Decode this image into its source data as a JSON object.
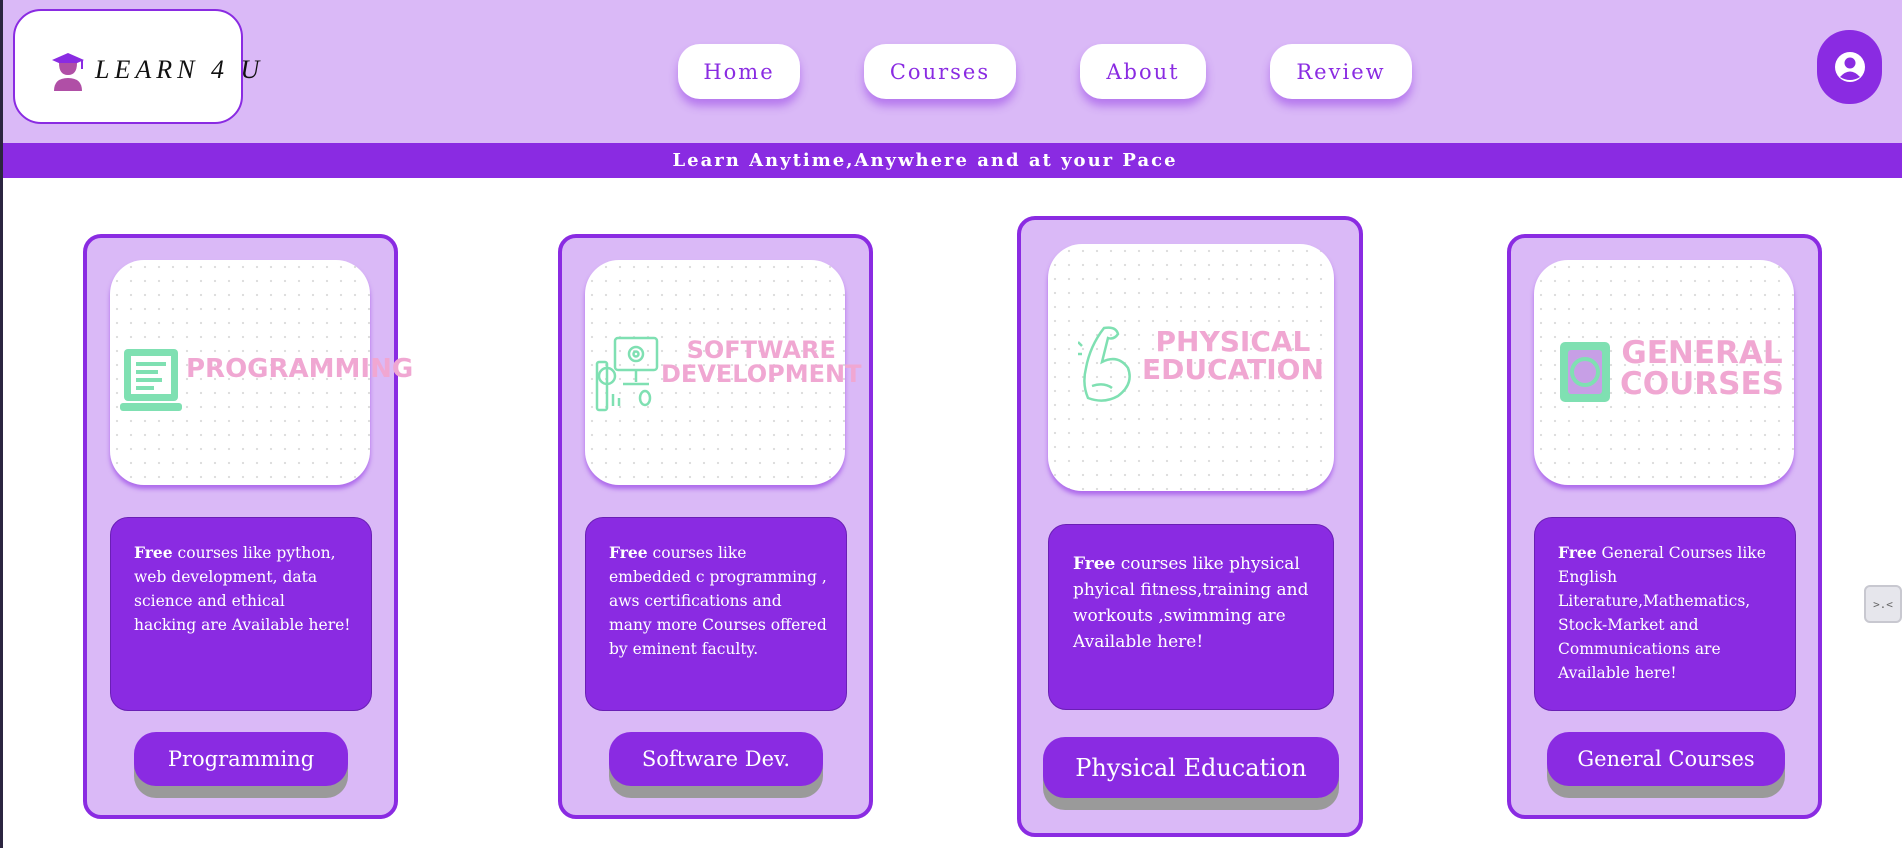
{
  "logo": {
    "text": "LEARN 4 U",
    "icon": "graduate-icon"
  },
  "nav": {
    "home": "Home",
    "courses": "Courses",
    "about": "About",
    "review": "Review"
  },
  "profile": {
    "icon": "user-circle-icon"
  },
  "banner": {
    "text": "Learn Anytime,Anywhere and at your Pace"
  },
  "colors": {
    "accent": "#8a2be2",
    "header_bg": "#dab9f7",
    "card_bg": "#dab9f7",
    "img_label": "#f0a7d2",
    "img_icon": "#7fe0b2"
  },
  "cards": [
    {
      "image_title": "PROGRAMMING",
      "image_icon": "laptop-code-icon",
      "desc_bold": "Free",
      "desc_text": " courses like python, web development, data science and ethical hacking are Available here!",
      "button": "Programming"
    },
    {
      "image_title": "SOFTWARE\nDEVELOPMENT",
      "image_icon": "computer-gear-icon",
      "desc_bold": "Free",
      "desc_text": " courses like embedded c programming , aws certifications and many more Courses offered by eminent faculty.",
      "button": "Software Dev."
    },
    {
      "image_title": "PHYSICAL\nEDUCATION",
      "image_icon": "flexed-arm-icon",
      "desc_bold": "Free",
      "desc_text": " courses like physical phyical fitness,training and workouts ,swimming are Available here!",
      "button": "Physical Education"
    },
    {
      "image_title": "GENERAL\nCOURSES",
      "image_icon": "book-icon",
      "desc_bold": "Free",
      "desc_text": " General Courses like English Literature,Mathematics, Stock-Market and Communications are Available here!",
      "button": "General Courses"
    }
  ],
  "side_tab": {
    "label": ">.<",
    "icon": "terminal-icon"
  }
}
